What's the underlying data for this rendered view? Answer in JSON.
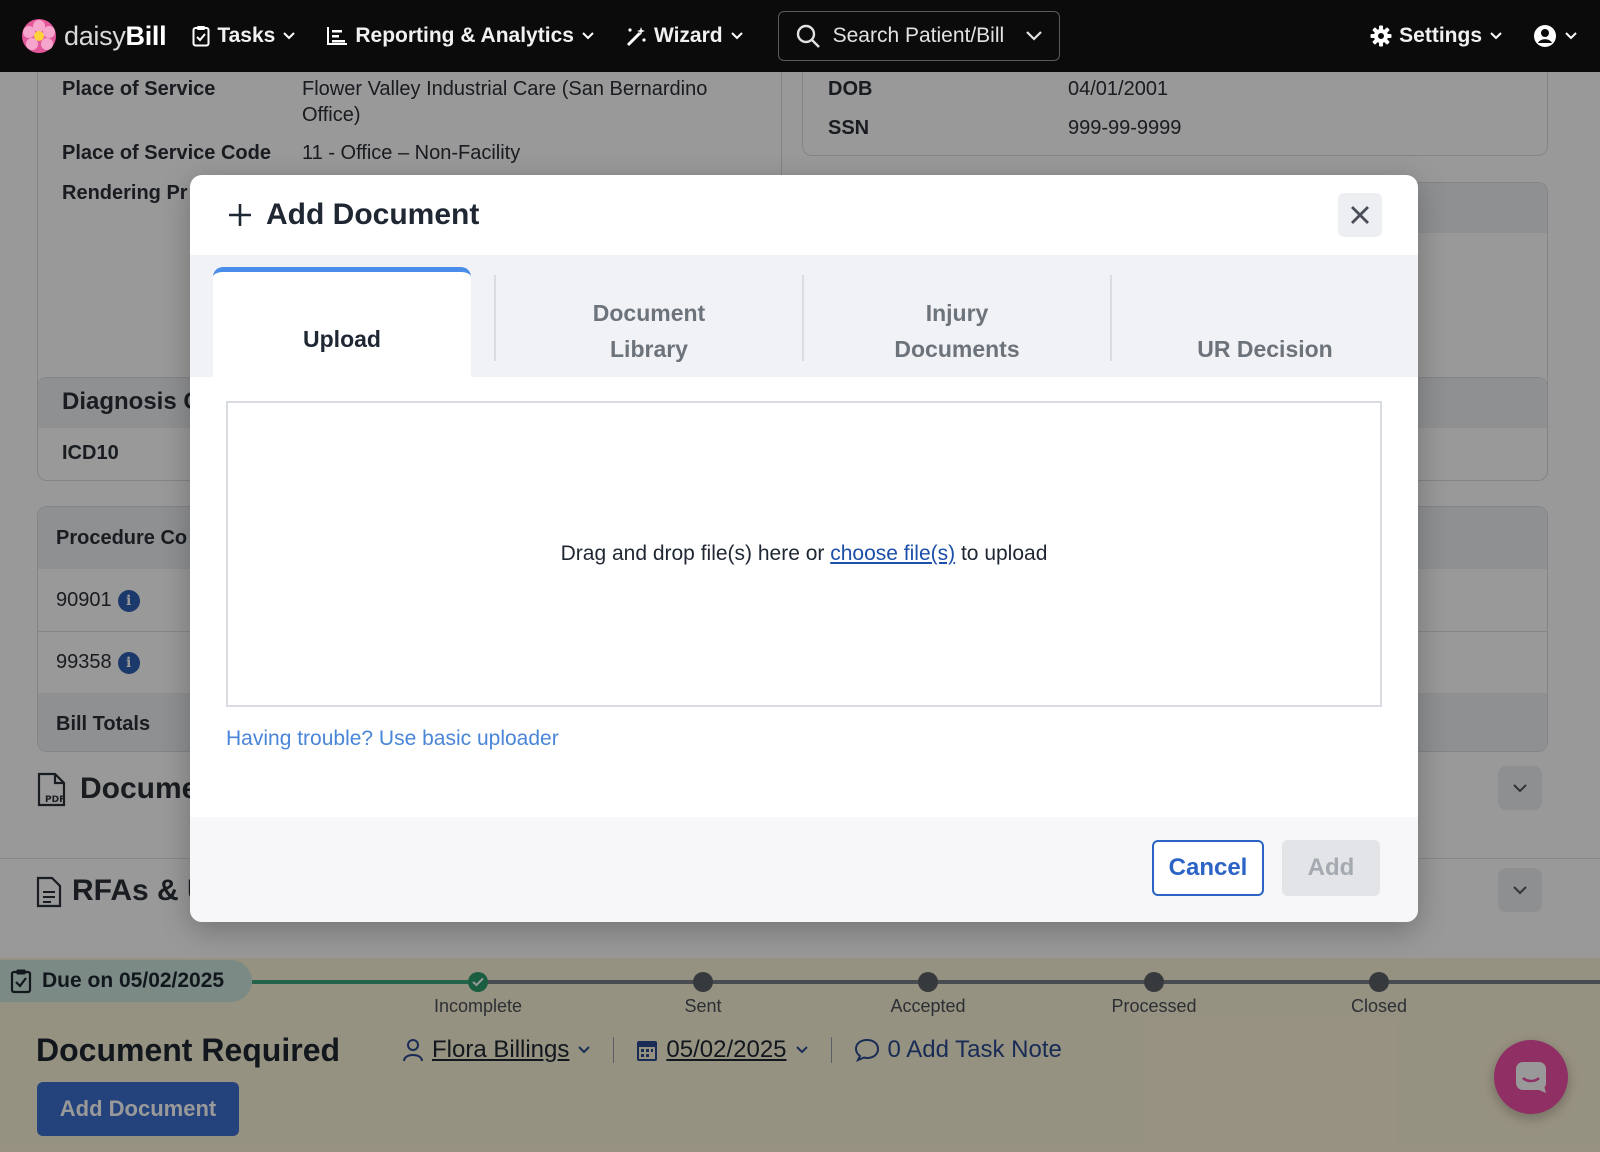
{
  "nav": {
    "logo_light": "daisy",
    "logo_bold": "Bill",
    "tasks": "Tasks",
    "reporting": "Reporting & Analytics",
    "wizard": "Wizard",
    "search_placeholder": "Search Patient/Bill",
    "settings": "Settings"
  },
  "bill_info": {
    "place_of_service_label": "Place of Service",
    "place_of_service_value": "Flower Valley Industrial Care (San Bernardino Office)",
    "pos_code_label": "Place of Service Code",
    "pos_code_value": "11 - Office – Non-Facility",
    "rendering_label": "Rendering Pr"
  },
  "patient_info": {
    "dob_label": "DOB",
    "dob_value": "04/01/2001",
    "ssn_label": "SSN",
    "ssn_value": "999-99-9999"
  },
  "diagnosis": {
    "title": "Diagnosis C",
    "icd_label": "ICD10"
  },
  "procedures": {
    "header": "Procedure Co",
    "rows": [
      "90901",
      "99358"
    ],
    "totals_label": "Bill Totals"
  },
  "sections": {
    "documents": "Docume",
    "rfas": "RFAs & U"
  },
  "task": {
    "due": "Due on 05/02/2025",
    "steps": [
      "Incomplete",
      "Sent",
      "Accepted",
      "Processed",
      "Closed"
    ],
    "title": "Document Required",
    "assignee": "Flora Billings",
    "date": "05/02/2025",
    "note": "0 Add Task Note",
    "add_button": "Add Document"
  },
  "modal": {
    "title": "Add Document",
    "tabs": [
      "Upload",
      "Document Library",
      "Injury Documents",
      "UR Decision"
    ],
    "tab_upload": "Upload",
    "tab_library_1": "Document",
    "tab_library_2": "Library",
    "tab_injury_1": "Injury",
    "tab_injury_2": "Documents",
    "tab_ur": "UR Decision",
    "drop_before": "Drag and drop file(s) here or ",
    "drop_link": "choose file(s)",
    "drop_after": " to upload",
    "basic_uploader": "Having trouble? Use basic uploader",
    "cancel": "Cancel",
    "add": "Add"
  },
  "colors": {
    "accent": "#4a8cea",
    "primary_button": "#3d6fcf",
    "link": "#1c4fa8",
    "chat": "#ee4fa5"
  }
}
